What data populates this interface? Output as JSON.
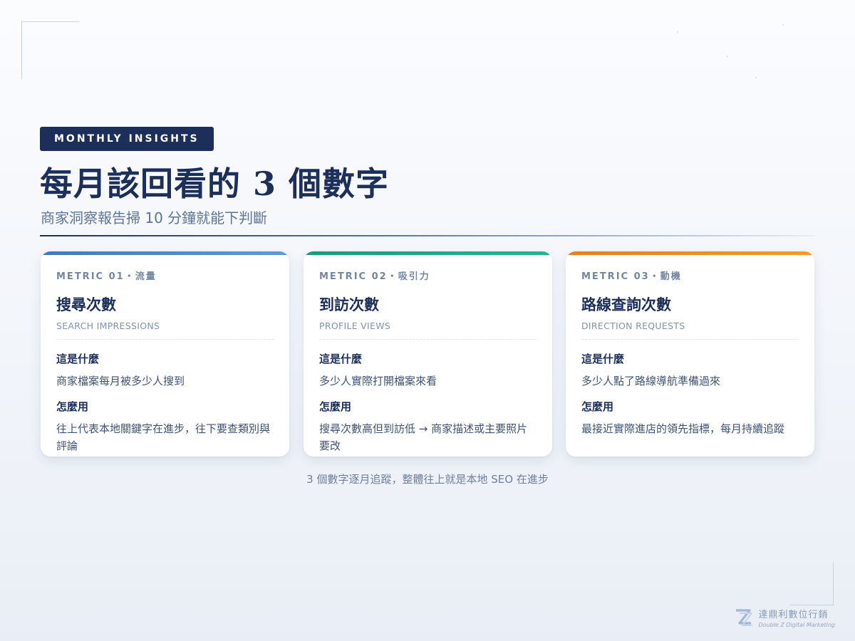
{
  "header": {
    "eyebrow": "MONTHLY INSIGHTS",
    "title": "每月該回看的 3 個數字",
    "subtitle": "商家洞察報告掃 10 分鐘就能下判斷"
  },
  "cards": [
    {
      "tag": "METRIC 01・流量",
      "title": "搜尋次數",
      "title_en": "SEARCH IMPRESSIONS",
      "what_label": "這是什麼",
      "what_text": "商家檔案每月被多少人搜到",
      "how_label": "怎麼用",
      "how_text": "往上代表本地關鍵字在進步，往下要查類別與評論",
      "accent": "#4a86c8"
    },
    {
      "tag": "METRIC 02・吸引力",
      "title": "到訪次數",
      "title_en": "PROFILE VIEWS",
      "what_label": "這是什麼",
      "what_text": "多少人實際打開檔案來看",
      "how_label": "怎麼用",
      "how_text": "搜尋次數高但到訪低 → 商家描述或主要照片要改",
      "accent": "#1ba784"
    },
    {
      "tag": "METRIC 03・動機",
      "title": "路線查詢次數",
      "title_en": "DIRECTION REQUESTS",
      "what_label": "這是什麼",
      "what_text": "多少人點了路線導航準備過來",
      "how_label": "怎麼用",
      "how_text": "最接近實際進店的領先指標，每月持續追蹤",
      "accent": "#ee8a1f"
    }
  ],
  "footer_note": "3 個數字逐月追蹤，整體往上就是本地 SEO 在進步",
  "brand": {
    "name": "達鼎利數位行銷",
    "tagline": "Double Z Digital Marketing",
    "icon": "double-z-logo"
  },
  "colors": {
    "navy": "#1b2f5a",
    "blue_accent": "#4a86c8",
    "green_accent": "#1ba784",
    "orange_accent": "#ee8a1f"
  }
}
